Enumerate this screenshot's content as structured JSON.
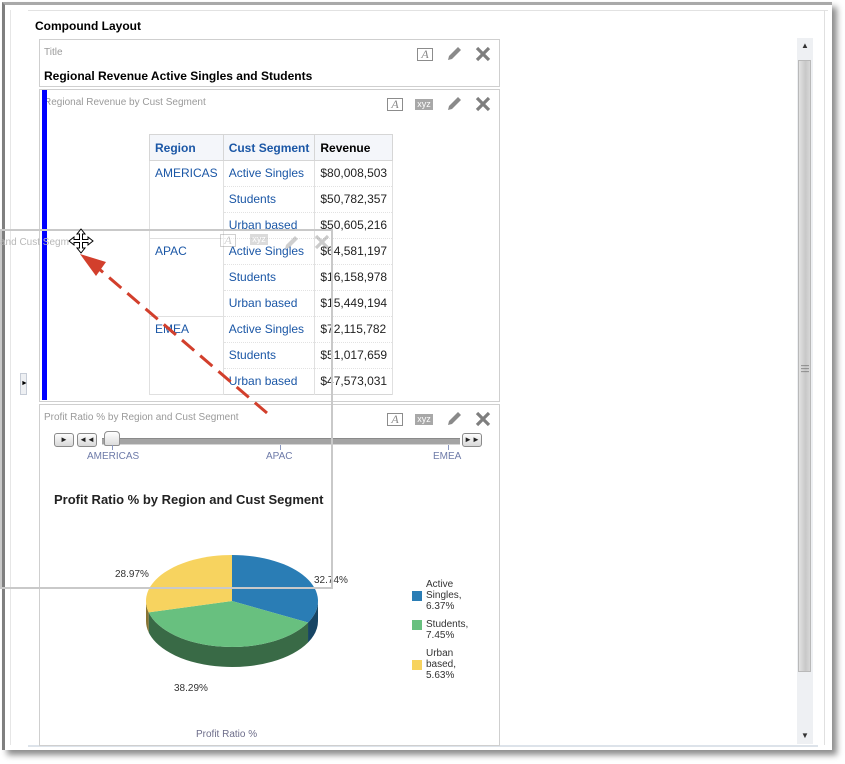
{
  "compound_layout": {
    "title": "Compound Layout"
  },
  "views": [
    {
      "type_label": "Title",
      "content": "Regional Revenue Active Singles and Students",
      "tools": [
        "format-icon",
        "edit-icon",
        "remove-icon"
      ]
    },
    {
      "type_label": "Regional Revenue by Cust Segment",
      "tools": [
        "format-icon",
        "xyz-icon",
        "edit-icon",
        "remove-icon"
      ],
      "table": {
        "headers": [
          "Region",
          "Cust Segment",
          "Revenue"
        ],
        "groups": [
          {
            "region": "AMERICAS",
            "rows": [
              {
                "segment": "Active Singles",
                "revenue": "$80,008,503"
              },
              {
                "segment": "Students",
                "revenue": "$50,782,357"
              },
              {
                "segment": "Urban based",
                "revenue": "$50,605,216"
              }
            ]
          },
          {
            "region": "APAC",
            "rows": [
              {
                "segment": "Active Singles",
                "revenue": "$64,581,197"
              },
              {
                "segment": "Students",
                "revenue": "$16,158,978"
              },
              {
                "segment": "Urban based",
                "revenue": "$15,449,194"
              }
            ]
          },
          {
            "region": "EMEA",
            "rows": [
              {
                "segment": "Active Singles",
                "revenue": "$72,115,782"
              },
              {
                "segment": "Students",
                "revenue": "$51,017,659"
              },
              {
                "segment": "Urban based",
                "revenue": "$47,573,031"
              }
            ]
          }
        ]
      }
    },
    {
      "type_label": "Profit Ratio % by Region and Cust Segment",
      "tools": [
        "format-icon",
        "xyz-icon",
        "edit-icon",
        "remove-icon"
      ],
      "slider": {
        "labels": [
          "AMERICAS",
          "APAC",
          "EMEA"
        ],
        "selected": "AMERICAS",
        "buttons": {
          "play": "►",
          "prev": "◄◄",
          "next": "►►"
        }
      }
    }
  ],
  "drag_ghost": {
    "label": "and Cust Segm"
  },
  "scrollbar": {
    "up": "▲",
    "down": "▼",
    "grip": "≡"
  },
  "collapse_handle": "►",
  "chart_data": {
    "type": "pie",
    "title": "Profit Ratio % by Region and Cust Segment",
    "xlabel": "Profit Ratio %",
    "slice_labels": [
      "32.74%",
      "38.29%",
      "28.97%"
    ],
    "series": [
      {
        "name": "Active Singles",
        "legend": "Active Singles, 6.37%",
        "value": 6.37,
        "percent": 32.74,
        "color": "#2a7db5"
      },
      {
        "name": "Students",
        "legend": "Students, 7.45%",
        "value": 7.45,
        "percent": 38.29,
        "color": "#68c07f"
      },
      {
        "name": "Urban based",
        "legend": "Urban based, 5.63%",
        "value": 5.63,
        "percent": 28.97,
        "color": "#f7d35f"
      }
    ],
    "legend_position": "right",
    "three_d": true
  }
}
